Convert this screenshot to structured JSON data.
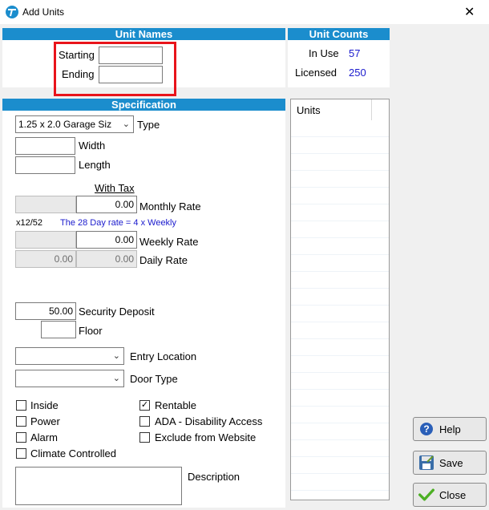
{
  "window": {
    "title": "Add Units",
    "close_glyph": "✕"
  },
  "unit_names": {
    "header": "Unit Names",
    "starting_label": "Starting",
    "starting_value": "",
    "ending_label": "Ending",
    "ending_value": ""
  },
  "unit_counts": {
    "header": "Unit Counts",
    "in_use_label": "In Use",
    "in_use_value": "57",
    "licensed_label": "Licensed",
    "licensed_value": "250"
  },
  "units_list": {
    "header": "Units",
    "rows": []
  },
  "specification": {
    "header": "Specification",
    "type_value": "1.25 x 2.0 Garage Siz",
    "type_label": "Type",
    "width_label": "Width",
    "width_value": "",
    "length_label": "Length",
    "length_value": "",
    "with_tax_label": "With Tax",
    "monthly_value": "0.00",
    "monthly_label": "Monthly Rate",
    "x12_label": "x12/52",
    "rate_note": "The 28 Day rate = 4 x Weekly",
    "weekly_value": "0.00",
    "weekly_label": "Weekly Rate",
    "daily_value_left": "0.00",
    "daily_value": "0.00",
    "daily_label": "Daily Rate",
    "deposit_value": "50.00",
    "deposit_label": "Security Deposit",
    "floor_value": "",
    "floor_label": "Floor",
    "entry_location_value": "",
    "entry_location_label": "Entry Location",
    "door_type_value": "",
    "door_type_label": "Door Type",
    "checkboxes_left": [
      {
        "label": "Inside",
        "checked": false
      },
      {
        "label": "Power",
        "checked": false
      },
      {
        "label": "Alarm",
        "checked": false
      },
      {
        "label": "Climate Controlled",
        "checked": false
      }
    ],
    "checkboxes_right": [
      {
        "label": "Rentable",
        "checked": true
      },
      {
        "label": "ADA - Disability Access",
        "checked": false
      },
      {
        "label": "Exclude from Website",
        "checked": false
      }
    ],
    "description_label": "Description",
    "description_value": ""
  },
  "buttons": {
    "help": "Help",
    "save": "Save",
    "close": "Close"
  },
  "colors": {
    "header_bg": "#1b8dcd",
    "count_text": "#1a1acd",
    "highlight": "#e8141b"
  }
}
